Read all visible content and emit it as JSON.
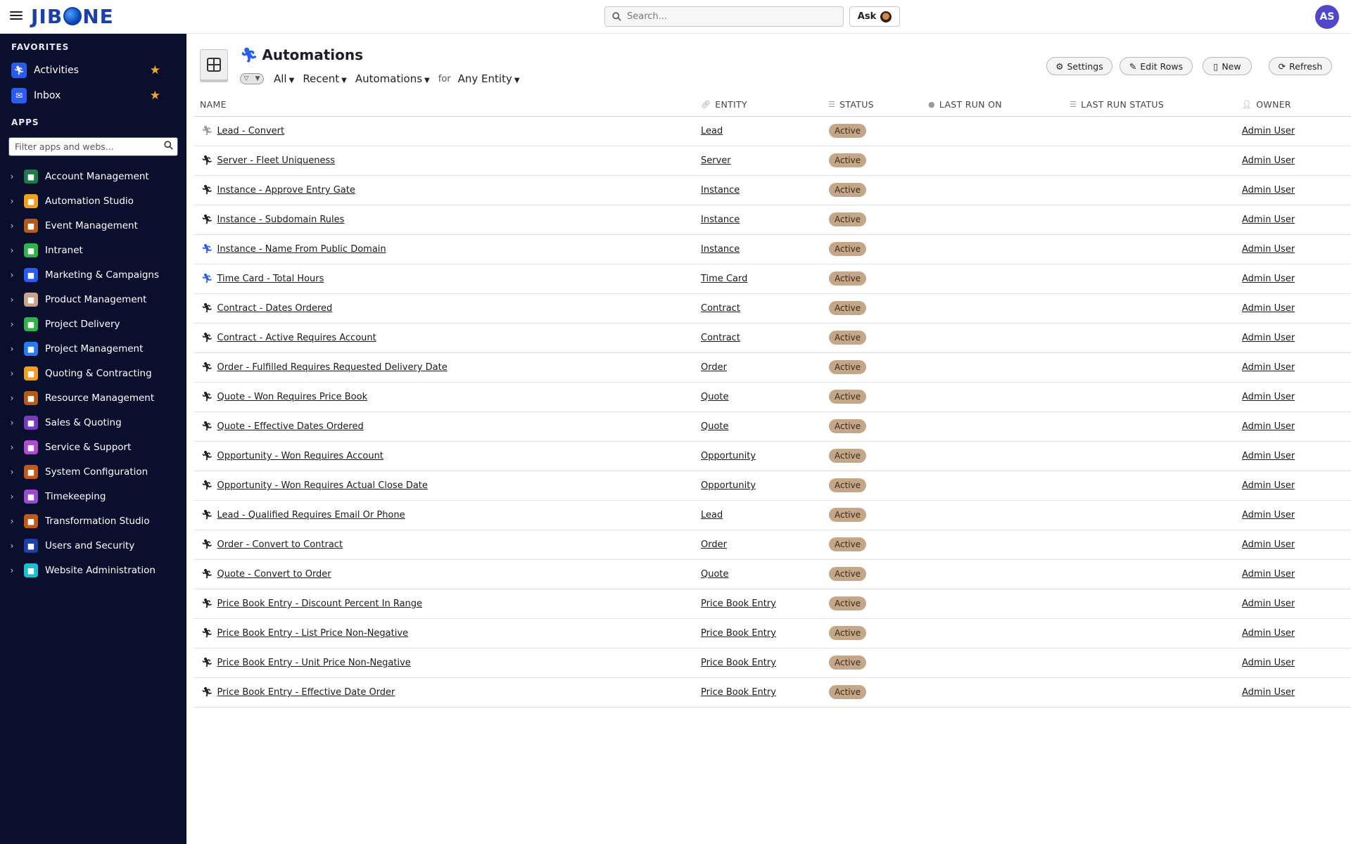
{
  "header": {
    "logo_text_left": "JIB",
    "logo_text_right": "NE",
    "search_placeholder": "Search...",
    "ask_label": "Ask",
    "avatar_initials": "AS"
  },
  "sidebar": {
    "favorites_title": "FAVORITES",
    "favorites": [
      {
        "label": "Activities",
        "icon": "running-icon",
        "color": "#2a5cf0"
      },
      {
        "label": "Inbox",
        "icon": "mail-icon",
        "color": "#2a5cf0"
      }
    ],
    "apps_title": "APPS",
    "filter_placeholder": "Filter apps and webs...",
    "apps": [
      {
        "label": "Account Management",
        "color": "#1f7a4a"
      },
      {
        "label": "Automation Studio",
        "color": "#f0a020"
      },
      {
        "label": "Event Management",
        "color": "#b45a1a"
      },
      {
        "label": "Intranet",
        "color": "#2fb34a"
      },
      {
        "label": "Marketing & Campaigns",
        "color": "#2a5cf0"
      },
      {
        "label": "Product Management",
        "color": "#c9a38a"
      },
      {
        "label": "Project Delivery",
        "color": "#2fb34a"
      },
      {
        "label": "Project Management",
        "color": "#2a7af0"
      },
      {
        "label": "Quoting & Contracting",
        "color": "#f0a020"
      },
      {
        "label": "Resource Management",
        "color": "#b45a1a"
      },
      {
        "label": "Sales & Quoting",
        "color": "#7a3ac0"
      },
      {
        "label": "Service & Support",
        "color": "#b04ad0"
      },
      {
        "label": "System Configuration",
        "color": "#c05a1a"
      },
      {
        "label": "Timekeeping",
        "color": "#9a4ad0"
      },
      {
        "label": "Transformation Studio",
        "color": "#c05a1a"
      },
      {
        "label": "Users and Security",
        "color": "#1d3fa8"
      },
      {
        "label": "Website Administration",
        "color": "#1ac0d0"
      }
    ]
  },
  "main": {
    "title": "Automations",
    "filters": {
      "scope": "All",
      "sort": "Recent",
      "type": "Automations",
      "for_label": "for",
      "entity": "Any Entity"
    },
    "buttons": {
      "settings": "Settings",
      "edit_rows": "Edit Rows",
      "new": "New",
      "refresh": "Refresh"
    },
    "columns": [
      "NAME",
      "ENTITY",
      "STATUS",
      "LAST RUN ON",
      "LAST RUN STATUS",
      "OWNER"
    ],
    "rows": [
      {
        "name": "Lead - Convert",
        "entity": "Lead",
        "status": "Active",
        "owner": "Admin User",
        "icon_color": "#999999"
      },
      {
        "name": "Server - Fleet Uniqueness",
        "entity": "Server",
        "status": "Active",
        "owner": "Admin User",
        "icon_color": "#222222"
      },
      {
        "name": "Instance - Approve Entry Gate",
        "entity": "Instance",
        "status": "Active",
        "owner": "Admin User",
        "icon_color": "#222222"
      },
      {
        "name": "Instance - Subdomain Rules",
        "entity": "Instance",
        "status": "Active",
        "owner": "Admin User",
        "icon_color": "#222222"
      },
      {
        "name": "Instance - Name From Public Domain",
        "entity": "Instance",
        "status": "Active",
        "owner": "Admin User",
        "icon_color": "#2a5cf0"
      },
      {
        "name": "Time Card - Total Hours",
        "entity": "Time Card",
        "status": "Active",
        "owner": "Admin User",
        "icon_color": "#2a5cf0"
      },
      {
        "name": "Contract - Dates Ordered",
        "entity": "Contract",
        "status": "Active",
        "owner": "Admin User",
        "icon_color": "#222222"
      },
      {
        "name": "Contract - Active Requires Account",
        "entity": "Contract",
        "status": "Active",
        "owner": "Admin User",
        "icon_color": "#222222"
      },
      {
        "name": "Order - Fulfilled Requires Requested Delivery Date",
        "entity": "Order",
        "status": "Active",
        "owner": "Admin User",
        "icon_color": "#222222"
      },
      {
        "name": "Quote - Won Requires Price Book",
        "entity": "Quote",
        "status": "Active",
        "owner": "Admin User",
        "icon_color": "#222222"
      },
      {
        "name": "Quote - Effective Dates Ordered",
        "entity": "Quote",
        "status": "Active",
        "owner": "Admin User",
        "icon_color": "#222222"
      },
      {
        "name": "Opportunity - Won Requires Account",
        "entity": "Opportunity",
        "status": "Active",
        "owner": "Admin User",
        "icon_color": "#222222"
      },
      {
        "name": "Opportunity - Won Requires Actual Close Date",
        "entity": "Opportunity",
        "status": "Active",
        "owner": "Admin User",
        "icon_color": "#222222"
      },
      {
        "name": "Lead - Qualified Requires Email Or Phone",
        "entity": "Lead",
        "status": "Active",
        "owner": "Admin User",
        "icon_color": "#222222"
      },
      {
        "name": "Order - Convert to Contract",
        "entity": "Order",
        "status": "Active",
        "owner": "Admin User",
        "icon_color": "#222222"
      },
      {
        "name": "Quote - Convert to Order",
        "entity": "Quote",
        "status": "Active",
        "owner": "Admin User",
        "icon_color": "#222222"
      },
      {
        "name": "Price Book Entry - Discount Percent In Range",
        "entity": "Price Book Entry",
        "status": "Active",
        "owner": "Admin User",
        "icon_color": "#222222"
      },
      {
        "name": "Price Book Entry - List Price Non-Negative",
        "entity": "Price Book Entry",
        "status": "Active",
        "owner": "Admin User",
        "icon_color": "#222222"
      },
      {
        "name": "Price Book Entry - Unit Price Non-Negative",
        "entity": "Price Book Entry",
        "status": "Active",
        "owner": "Admin User",
        "icon_color": "#222222"
      },
      {
        "name": "Price Book Entry - Effective Date Order",
        "entity": "Price Book Entry",
        "status": "Active",
        "owner": "Admin User",
        "icon_color": "#222222"
      }
    ]
  }
}
